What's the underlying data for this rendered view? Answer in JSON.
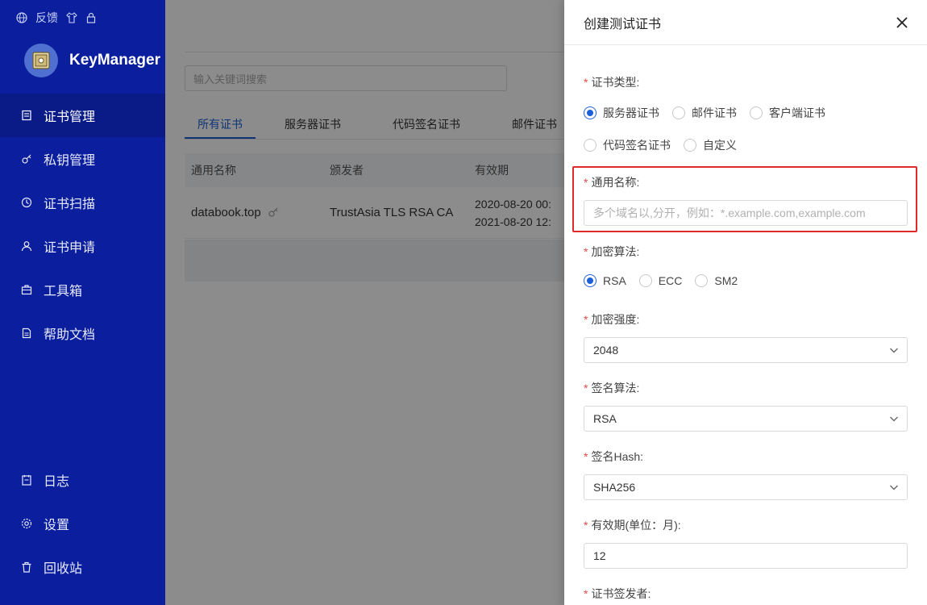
{
  "sidebar": {
    "top_links": {
      "feedback": "反馈"
    },
    "brand": "KeyManager",
    "nav": [
      {
        "label": "证书管理",
        "icon": "certificate-icon",
        "active": true
      },
      {
        "label": "私钥管理",
        "icon": "key-icon"
      },
      {
        "label": "证书扫描",
        "icon": "scan-icon"
      },
      {
        "label": "证书申请",
        "icon": "user-icon"
      },
      {
        "label": "工具箱",
        "icon": "toolbox-icon"
      },
      {
        "label": "帮助文档",
        "icon": "document-icon"
      }
    ],
    "bottom_nav": [
      {
        "label": "日志",
        "icon": "log-icon"
      },
      {
        "label": "设置",
        "icon": "gear-icon"
      },
      {
        "label": "回收站",
        "icon": "trash-icon"
      }
    ]
  },
  "main": {
    "search_placeholder": "输入关键词搜索",
    "tabs": [
      "所有证书",
      "服务器证书",
      "代码签名证书",
      "邮件证书"
    ],
    "table": {
      "headers": [
        "通用名称",
        "颁发者",
        "有效期"
      ],
      "rows": [
        {
          "name": "databook.top",
          "issuer": "TrustAsia TLS RSA CA",
          "valid_from": "2020-08-20 00:",
          "valid_to": "2021-08-20 12:"
        }
      ]
    }
  },
  "drawer": {
    "title": "创建测试证书",
    "cert_type": {
      "label": "证书类型:",
      "options": [
        "服务器证书",
        "邮件证书",
        "客户端证书",
        "代码签名证书",
        "自定义"
      ],
      "selected": "服务器证书"
    },
    "common_name": {
      "label": "通用名称:",
      "placeholder": "多个域名以,分开，例如：*.example.com,example.com"
    },
    "algorithm": {
      "label": "加密算法:",
      "options": [
        "RSA",
        "ECC",
        "SM2"
      ],
      "selected": "RSA"
    },
    "strength": {
      "label": "加密强度:",
      "value": "2048"
    },
    "sign_algorithm": {
      "label": "签名算法:",
      "value": "RSA"
    },
    "sign_hash": {
      "label": "签名Hash:",
      "value": "SHA256"
    },
    "validity": {
      "label": "有效期(单位：月):",
      "value": "12"
    },
    "issuer": {
      "label": "证书签发者:"
    }
  },
  "colors": {
    "sidebar": "#0b1f9e",
    "primary": "#1e5fd8",
    "highlight": "#e02b2b",
    "required": "#e84747"
  }
}
